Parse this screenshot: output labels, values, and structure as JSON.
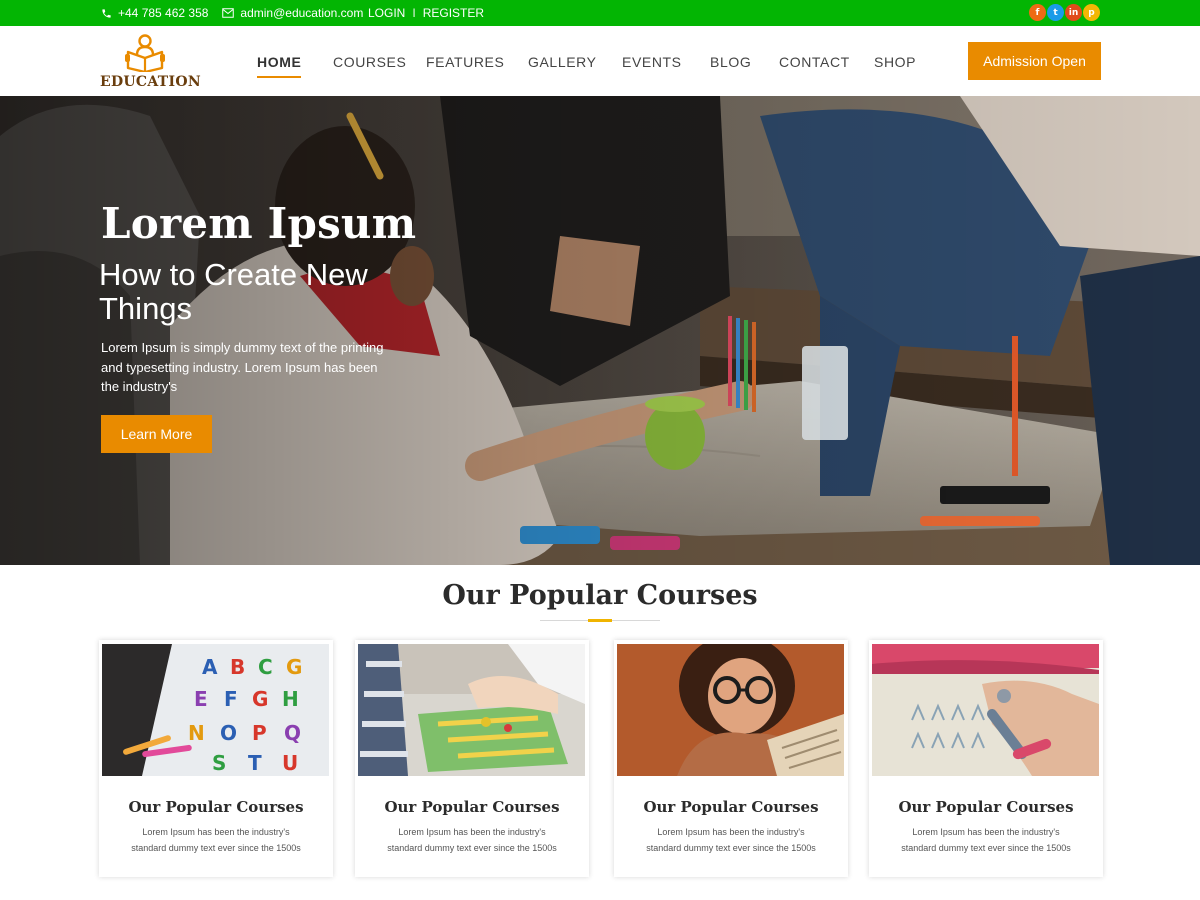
{
  "topbar": {
    "phone": "+44 785 462 358",
    "email": "admin@education.com",
    "login": "LOGIN",
    "separator": "I",
    "register": "REGISTER",
    "social": [
      {
        "icon": "facebook-icon",
        "glyph": "f",
        "color": "#ee6a14"
      },
      {
        "icon": "twitter-icon",
        "glyph": "t",
        "color": "#1a9be8"
      },
      {
        "icon": "linkedin-icon",
        "glyph": "in",
        "color": "#e14b1b"
      },
      {
        "icon": "pinterest-icon",
        "glyph": "p",
        "color": "#f2b705"
      }
    ]
  },
  "header": {
    "logo_text": "EDUCATION",
    "nav": [
      "HOME",
      "COURSES",
      "FEATURES",
      "GALLERY",
      "EVENTS",
      "BLOG",
      "CONTACT",
      "SHOP"
    ],
    "active_nav": "HOME",
    "cta": "Admission Open"
  },
  "hero": {
    "title": "Lorem Ipsum",
    "subtitle": "How to Create New Things",
    "text": "Lorem Ipsum is simply dummy text of the printing and typesetting industry. Lorem Ipsum has been the industry's",
    "button": "Learn More"
  },
  "courses": {
    "heading": "Our Popular Courses",
    "items": [
      {
        "title": "Our Popular Courses",
        "text": "Lorem Ipsum has been the industry's standard dummy text ever since the 1500s"
      },
      {
        "title": "Our Popular Courses",
        "text": "Lorem Ipsum has been the industry's standard dummy text ever since the 1500s"
      },
      {
        "title": "Our Popular Courses",
        "text": "Lorem Ipsum has been the industry's standard dummy text ever since the 1500s"
      },
      {
        "title": "Our Popular Courses",
        "text": "Lorem Ipsum has been the industry's standard dummy text ever since the 1500s"
      }
    ]
  },
  "colors": {
    "topbar": "#03b503",
    "accent": "#e98b00",
    "underline": "#f0b400",
    "logo_text": "#6a3e0e"
  }
}
